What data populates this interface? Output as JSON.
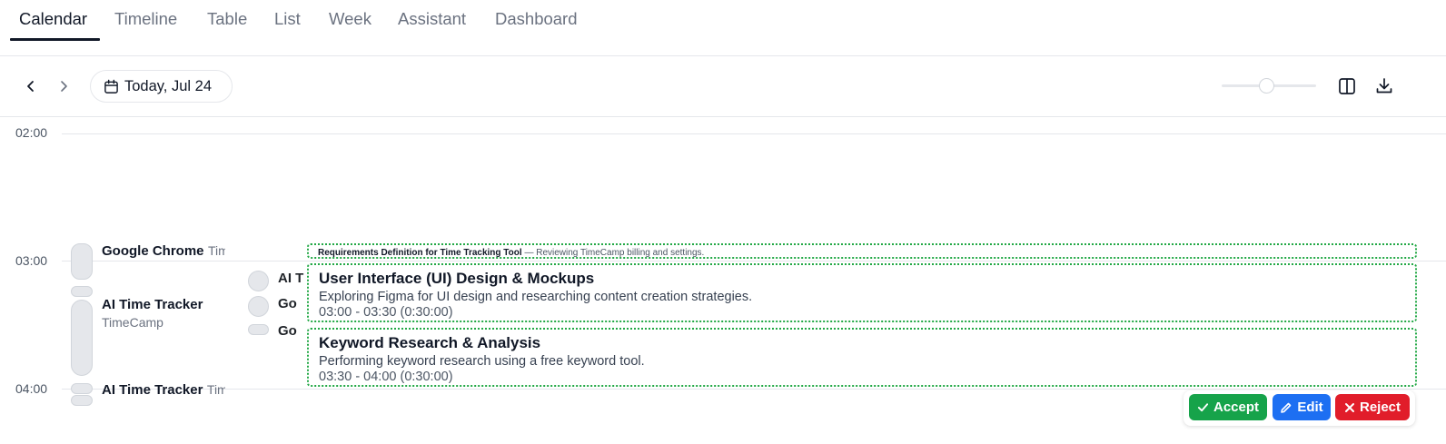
{
  "tabs": [
    "Calendar",
    "Timeline",
    "Table",
    "List",
    "Week",
    "Assistant",
    "Dashboard"
  ],
  "toolbar": {
    "date_label": "Today, Jul 24"
  },
  "time_labels": [
    "02:00",
    "03:00",
    "04:00"
  ],
  "activities": {
    "a1": {
      "name": "Google Chrome",
      "sub": "Tim"
    },
    "a2": {
      "name": "AI Time Tracker",
      "sub": "TimeCamp"
    },
    "a3": {
      "name": "AI Time Tracker",
      "sub": "Tim"
    },
    "c1": "AI T",
    "c2": "Go",
    "c3": "Go"
  },
  "cards": {
    "top": {
      "title": "Requirements Definition for Time Tracking Tool",
      "desc": " — Reviewing TimeCamp billing and settings."
    },
    "ui": {
      "title": "User Interface (UI) Design & Mockups",
      "desc": "Exploring Figma for UI design and researching content creation strategies.",
      "time": "03:00 - 03:30 (0:30:00)"
    },
    "kw": {
      "title": "Keyword Research & Analysis",
      "desc": "Performing keyword research using a free keyword tool.",
      "time": "03:30 - 04:00 (0:30:00)"
    }
  },
  "actions": {
    "accept": "Accept",
    "edit": "Edit",
    "reject": "Reject"
  },
  "colors": {
    "accept": "#16a34a",
    "edit": "#1d6ff2",
    "reject": "#e11d2a",
    "card_border": "#22a845"
  }
}
